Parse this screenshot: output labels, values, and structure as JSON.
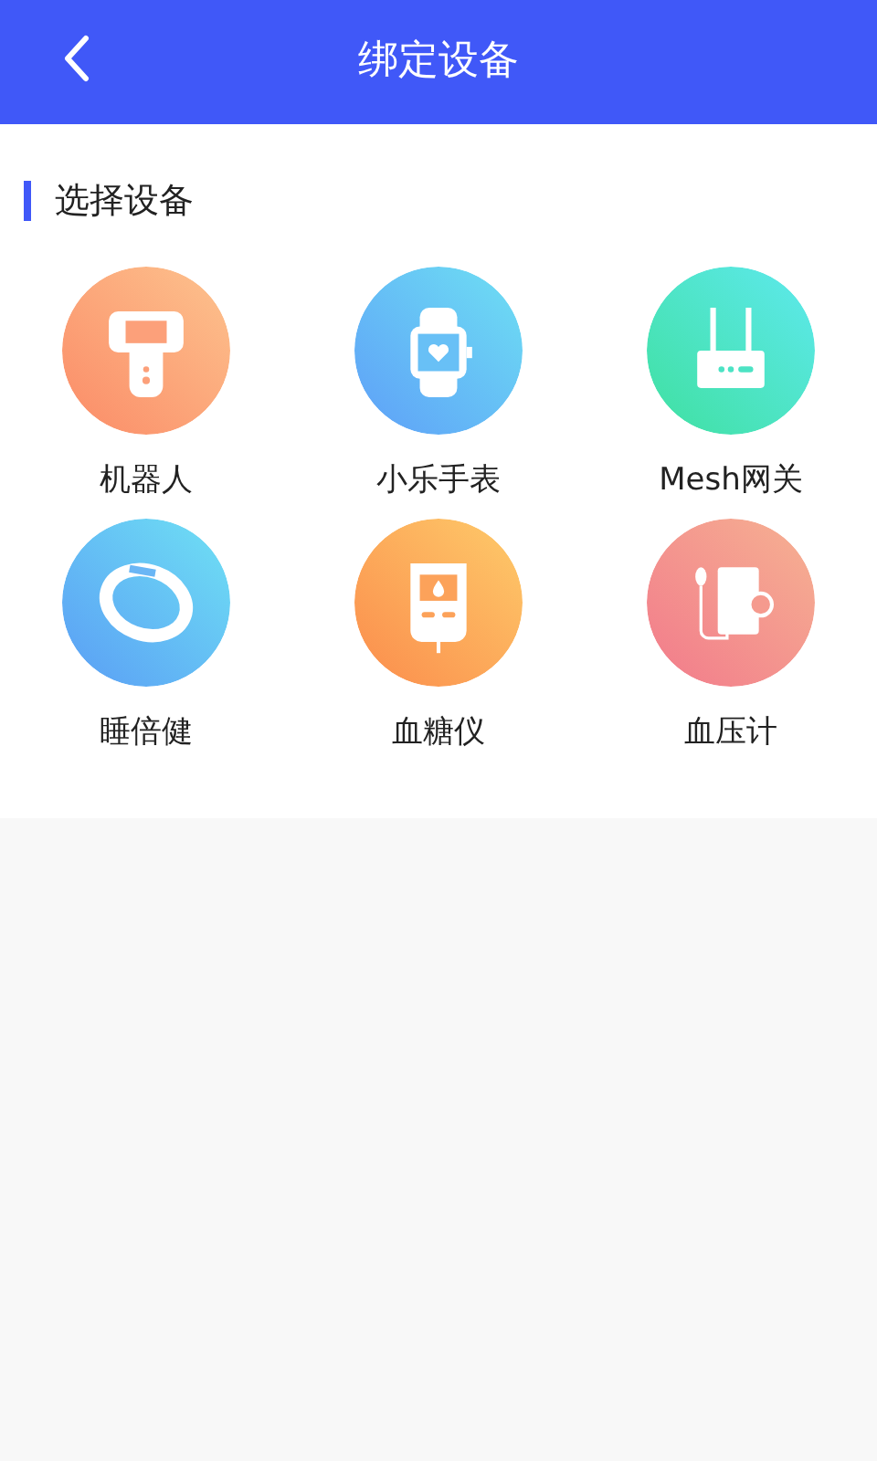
{
  "header": {
    "title": "绑定设备"
  },
  "section": {
    "title": "选择设备"
  },
  "devices": [
    {
      "label": "机器人",
      "kind": "robot"
    },
    {
      "label": "小乐手表",
      "kind": "watch"
    },
    {
      "label": "Mesh网关",
      "kind": "router"
    },
    {
      "label": "睡倍健",
      "kind": "band"
    },
    {
      "label": "血糖仪",
      "kind": "glucose"
    },
    {
      "label": "血压计",
      "kind": "pressure"
    }
  ]
}
